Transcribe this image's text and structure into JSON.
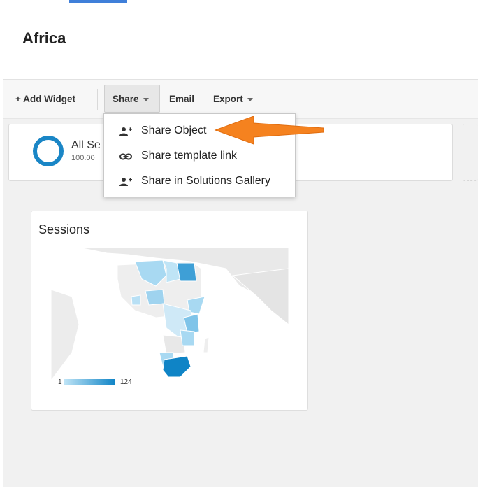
{
  "page": {
    "title": "Africa"
  },
  "toolbar": {
    "add_widget": "+ Add Widget",
    "share": "Share",
    "email": "Email",
    "export": "Export"
  },
  "segment": {
    "label": "All Se",
    "percent": "100.00"
  },
  "share_menu": {
    "items": [
      {
        "label": "Share Object",
        "icon": "add-person-icon"
      },
      {
        "label": "Share template link",
        "icon": "link-icon"
      },
      {
        "label": "Share in Solutions Gallery",
        "icon": "add-person-icon"
      }
    ]
  },
  "widget": {
    "title": "Sessions",
    "legend_min": "1",
    "legend_max": "124"
  },
  "colors": {
    "accent": "#3f7fd9",
    "ring": "#1a86c6",
    "arrow": "#f5821f",
    "map_low": "#bfe4f6",
    "map_high": "#0f84c6"
  }
}
